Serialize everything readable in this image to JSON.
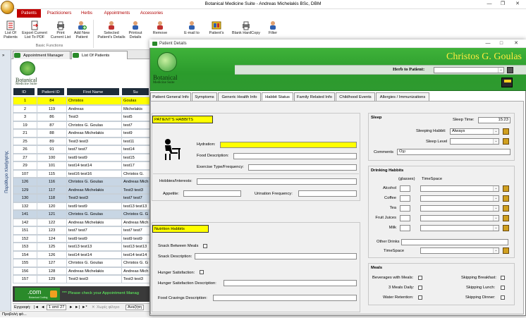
{
  "app": {
    "title": "Botanical Medicine Suite - Andreas Michelakis BSc, DBM"
  },
  "ribbon_tabs": [
    "Patients",
    "Practicioners",
    "Herbs",
    "Appointments",
    "Accessories"
  ],
  "ribbon_buttons": [
    {
      "label": "List Of\nPatients"
    },
    {
      "label": "Export Current\nList To PDF"
    },
    {
      "label": "Print\nCurrent List"
    },
    {
      "label": "Add New\nPatient"
    },
    {
      "label": "Selected\nPatient's Details"
    },
    {
      "label": "Printout\nDetails"
    },
    {
      "label": "Remove"
    },
    {
      "label": "E-mail to"
    },
    {
      "label": "Patient's"
    },
    {
      "label": "Blank HardCopy"
    },
    {
      "label": "Filter"
    }
  ],
  "ribbon_group": "Basic Functions",
  "left_panel": {
    "nav_label": "Παράθυρο πλοήγησης",
    "object_tabs": [
      "Appointment Manager",
      "List Of Patients"
    ],
    "logo_text": "Botanical",
    "logo_sub": "Medicine Suite",
    "columns": [
      "ID",
      "Patient ID",
      "First Name",
      "Su"
    ],
    "rows": [
      [
        "1",
        "84",
        "Christos",
        "Goulas"
      ],
      [
        "2",
        "119",
        "Andreas",
        "Michelakis"
      ],
      [
        "3",
        "86",
        "Test3",
        "test5"
      ],
      [
        "19",
        "87",
        "Christos G. Goulas",
        "test7"
      ],
      [
        "21",
        "88",
        "Andreas Michelakis",
        "test9"
      ],
      [
        "25",
        "89",
        "Test3 test3",
        "test11"
      ],
      [
        "26",
        "91",
        "test7 test7",
        "test14"
      ],
      [
        "27",
        "100",
        "test9 test9",
        "test15"
      ],
      [
        "29",
        "101",
        "test14 test14",
        "test17"
      ],
      [
        "107",
        "115",
        "test16 test16",
        "Christos G."
      ],
      [
        "126",
        "116",
        "Christos G. Goulas",
        "Andreas Mich"
      ],
      [
        "129",
        "117",
        "Andreas Michelakis",
        "Test3 test3"
      ],
      [
        "130",
        "118",
        "Test3 test3",
        "test7 test7"
      ],
      [
        "132",
        "120",
        "test9 test9",
        "test13 test13"
      ],
      [
        "141",
        "121",
        "Christos G. Goulas",
        "Christos G. G"
      ],
      [
        "142",
        "122",
        "Andreas Michelakis",
        "Andreas Mich"
      ],
      [
        "151",
        "123",
        "test7 test7",
        "test7 test7"
      ],
      [
        "152",
        "124",
        "test9 test9",
        "test9 test9"
      ],
      [
        "153",
        "125",
        "test13 test13",
        "test13 test13"
      ],
      [
        "154",
        "126",
        "test14 test14",
        "test14 test14"
      ],
      [
        "155",
        "127",
        "Christos G. Goulas",
        "Christos G. G"
      ],
      [
        "156",
        "128",
        "Andreas Michelakis",
        "Andreas Mich"
      ],
      [
        "157",
        "129",
        "Test3 test3",
        "Test3 test3"
      ]
    ],
    "footer_brand": ".com",
    "footer_brand_sub": "Botanical Coding",
    "footer_msg": "*** Please check your Appointment Manag",
    "record_label": "Εγγραφή:",
    "record_value": "1 από 27",
    "filter_label": "Χωρίς φίλτρο",
    "search_label": "Αναζήτη",
    "status": "Προβολή φό..."
  },
  "dialog": {
    "title": "Patient Details",
    "patient_name": "Christos G. Goulas",
    "herb_label": "Herb to Patient:",
    "logo_text": "Botanical",
    "logo_sub": "Medicine Suite",
    "tabs": [
      "Patient General Info",
      "Symptoms",
      "Generic Health Info",
      "Habbit Status",
      "Family Related Info",
      "Childhood Events",
      "Allergies / Immunizations"
    ],
    "habits": {
      "header": "PATIENT'S HABBITS",
      "hydration": "Hydration:",
      "food_desc": "Food Description:",
      "exercise": "Exercise Type/Frequency:",
      "hobbies": "Hobbies/Interests:",
      "appetite": "Appetite:",
      "urination": "Urination Frequency:"
    },
    "nutrition": {
      "header": "Nutrition Habbits",
      "snack_between": "Snack Between Meals",
      "snack_desc": "Snack Description:",
      "hunger_sat": "Hunger Satisfaction:",
      "hunger_sat_desc": "Hunger Satisfaction Description:",
      "food_cravings": "Food Cravings Description:"
    },
    "sleep": {
      "header": "Sleep",
      "time_label": "Sleep Time:",
      "time_value": "15:23",
      "habit_label": "Sleeping Habbit:",
      "habit_value": "Always",
      "level_label": "Sleep Level",
      "comments_label": "Comments",
      "comments_value": "Oχι"
    },
    "drinking": {
      "header": "Drinking Habbits",
      "col_glasses": "(glasses)",
      "col_timespace": "TimeSpace",
      "items": [
        "Alcohol",
        "Coffee",
        "Tea",
        "Fruit Juices",
        "Milk"
      ],
      "other": "Other Drinks",
      "timespace": "TimeSpace"
    },
    "meals": {
      "header": "Meals",
      "bev": "Beverages with Meals:",
      "three": "3 Meals Daily:",
      "water": "Water Retention:",
      "skip_b": "Skipping Breakfast:",
      "skip_l": "Skipping Lunch:",
      "skip_d": "Skipping Dinner:"
    }
  }
}
